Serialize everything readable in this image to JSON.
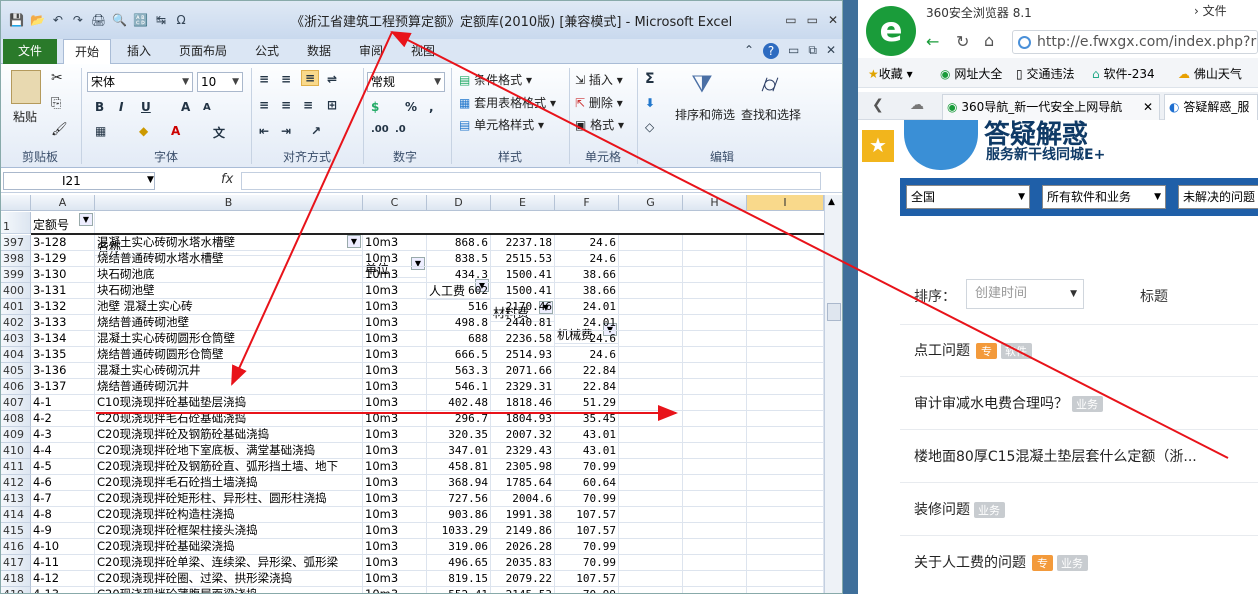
{
  "excel": {
    "window_title": "《浙江省建筑工程预算定额》定额库(2010版)  [兼容模式]  -  Microsoft Excel",
    "qat": [
      "💾",
      "📂",
      "↶",
      "↷",
      "🖨",
      "🔍",
      "🔠",
      "↹",
      "Ω"
    ],
    "window_controls": [
      "▭",
      "▭",
      "✕"
    ],
    "ribbon_controls": [
      "⌃",
      "?",
      "▭",
      "⧉",
      "✕"
    ],
    "tabs": [
      "文件",
      "开始",
      "插入",
      "页面布局",
      "公式",
      "数据",
      "审阅",
      "视图"
    ],
    "active_tab": "开始",
    "ribbon": {
      "paste": "粘贴",
      "clipboard_label": "剪贴板",
      "font_name": "宋体",
      "font_size": "10",
      "font_label": "字体",
      "align_label": "对齐方式",
      "number_format": "常规",
      "number_label": "数字",
      "cond_format": "条件格式",
      "table_format": "套用表格格式",
      "cell_style": "单元格样式",
      "style_label": "样式",
      "insert": "插入",
      "delete": "删除",
      "format": "格式",
      "cells_label": "单元格",
      "sort_filter": "排序和筛选",
      "find_select": "查找和选择",
      "edit_label": "编辑",
      "sum_icon": "Σ",
      "bold": "B",
      "italic": "I",
      "underline": "U",
      "percent": "%",
      "comma": ",",
      "font_grow": "A",
      "font_shrink": "A"
    },
    "name_box": "I21",
    "fx": "fx",
    "columns": [
      "A",
      "B",
      "C",
      "D",
      "E",
      "F",
      "G",
      "H",
      "I"
    ],
    "selected_column": "I",
    "header_row_num": "1",
    "headers": [
      "定额号",
      "名称",
      "单位",
      "人工费",
      "材料费",
      "机械费"
    ],
    "rows": [
      [
        "397",
        "3-128",
        "混凝土实心砖砌水塔水槽壁",
        "10m3",
        "868.6",
        "2237.18",
        "24.6"
      ],
      [
        "398",
        "3-129",
        "烧结普通砖砌水塔水槽壁",
        "10m3",
        "838.5",
        "2515.53",
        "24.6"
      ],
      [
        "399",
        "3-130",
        "块石砌池底",
        "10m3",
        "434.3",
        "1500.41",
        "38.66"
      ],
      [
        "400",
        "3-131",
        "块石砌池壁",
        "10m3",
        "602",
        "1500.41",
        "38.66"
      ],
      [
        "401",
        "3-132",
        "池壁 混凝土实心砖",
        "10m3",
        "516",
        "2170.46",
        "24.01"
      ],
      [
        "402",
        "3-133",
        "烧结普通砖砌池壁",
        "10m3",
        "498.8",
        "2440.81",
        "24.01"
      ],
      [
        "403",
        "3-134",
        "混凝土实心砖砌圆形仓筒壁",
        "10m3",
        "688",
        "2236.58",
        "24.6"
      ],
      [
        "404",
        "3-135",
        "烧结普通砖砌圆形仓筒壁",
        "10m3",
        "666.5",
        "2514.93",
        "24.6"
      ],
      [
        "405",
        "3-136",
        "混凝土实心砖砌沉井",
        "10m3",
        "563.3",
        "2071.66",
        "22.84"
      ],
      [
        "406",
        "3-137",
        "烧结普通砖砌沉井",
        "10m3",
        "546.1",
        "2329.31",
        "22.84"
      ],
      [
        "407",
        "4-1",
        "C10现浇现拌砼基础垫层浇捣",
        "10m3",
        "402.48",
        "1818.46",
        "51.29"
      ],
      [
        "408",
        "4-2",
        "C20现浇现拌毛石砼基础浇捣",
        "10m3",
        "296.7",
        "1804.93",
        "35.45"
      ],
      [
        "409",
        "4-3",
        "C20现浇现拌砼及钢筋砼基础浇捣",
        "10m3",
        "320.35",
        "2007.32",
        "43.01"
      ],
      [
        "410",
        "4-4",
        "C20现浇现拌砼地下室底板、满堂基础浇捣",
        "10m3",
        "347.01",
        "2329.43",
        "43.01"
      ],
      [
        "411",
        "4-5",
        "C20现浇现拌砼及钢筋砼直、弧形挡土墙、地下",
        "10m3",
        "458.81",
        "2305.98",
        "70.99"
      ],
      [
        "412",
        "4-6",
        "C20现浇现拌毛石砼挡土墙浇捣",
        "10m3",
        "368.94",
        "1785.64",
        "60.64"
      ],
      [
        "413",
        "4-7",
        "C20现浇现拌砼矩形柱、异形柱、圆形柱浇捣",
        "10m3",
        "727.56",
        "2004.6",
        "70.99"
      ],
      [
        "414",
        "4-8",
        "C20现浇现拌砼构造柱浇捣",
        "10m3",
        "903.86",
        "1991.38",
        "107.57"
      ],
      [
        "415",
        "4-9",
        "C20现浇现拌砼框架柱接头浇捣",
        "10m3",
        "1033.29",
        "2149.86",
        "107.57"
      ],
      [
        "416",
        "4-10",
        "C20现浇现拌砼基础梁浇捣",
        "10m3",
        "319.06",
        "2026.28",
        "70.99"
      ],
      [
        "417",
        "4-11",
        "C20现浇现拌砼单梁、连续梁、异形梁、弧形梁",
        "10m3",
        "496.65",
        "2035.83",
        "70.99"
      ],
      [
        "418",
        "4-12",
        "C20现浇现拌砼圈、过梁、拱形梁浇捣",
        "10m3",
        "819.15",
        "2079.22",
        "107.57"
      ],
      [
        "419",
        "4-13",
        "C20现浇现拌砼薄腹屋面梁浇捣",
        "10m3",
        "552.41",
        "2145.53",
        "70.99"
      ]
    ]
  },
  "browser": {
    "name": "360安全浏览器 8.1",
    "menu_file": "文件",
    "url": "http://e.fwxgx.com/index.php?r",
    "bookmarks": [
      "收藏",
      "网址大全",
      "交通违法",
      "软件-234",
      "佛山天气"
    ],
    "tabs": [
      "360导航_新一代安全上网导航",
      "答疑解惑_服"
    ],
    "site_title": "答疑解惑",
    "site_subtitle": "服务新干线同城E+",
    "filters": [
      "全国",
      "所有软件和业务",
      "未解决的问题"
    ],
    "sort_label": "排序：",
    "sort_value": "创建时间",
    "title_col": "标题",
    "questions": [
      {
        "title": "点工问题",
        "tags": [
          "专",
          "软件"
        ]
      },
      {
        "title": "审计审减水电费合理吗？",
        "tags": [
          "业务"
        ]
      },
      {
        "title": "楼地面80厚C15混凝土垫层套什么定额（浙...",
        "tags": []
      },
      {
        "title": "装修问题",
        "tags": [
          "业务"
        ]
      },
      {
        "title": "关于人工费的问题",
        "tags": [
          "专",
          "业务"
        ]
      }
    ]
  },
  "annotation_color": "#e8131a"
}
